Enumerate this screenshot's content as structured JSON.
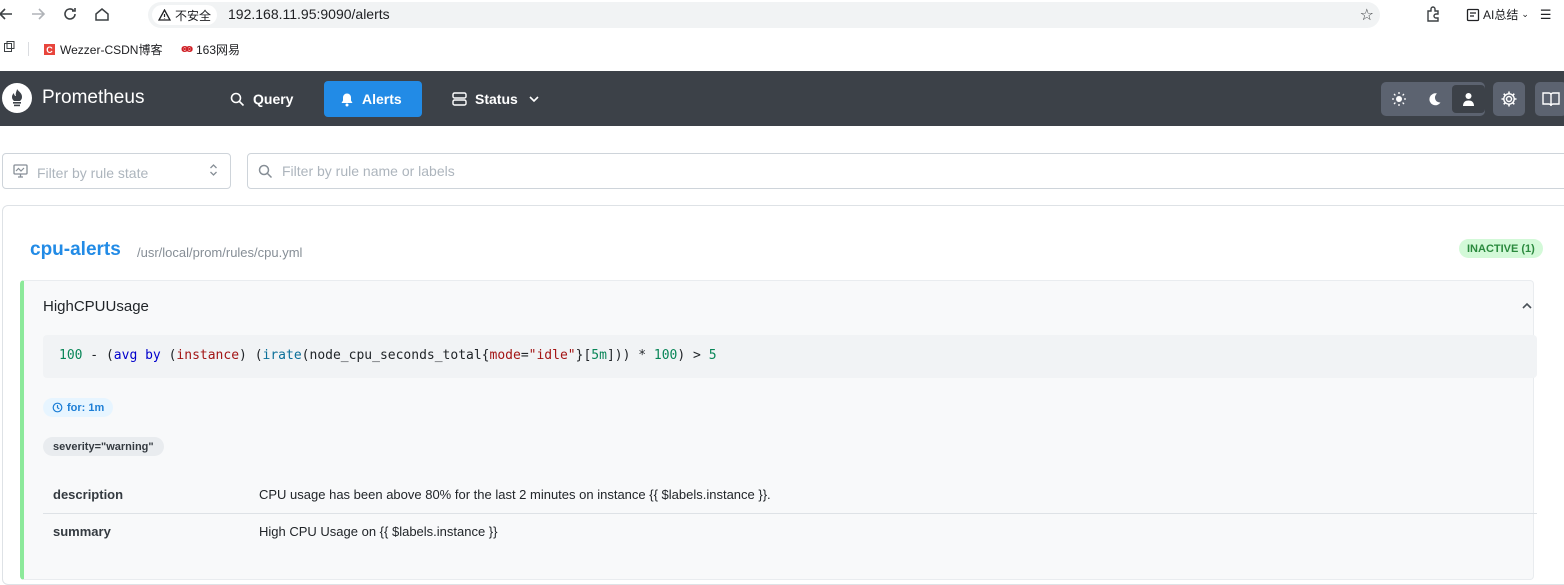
{
  "browser": {
    "security_label": "不安全",
    "url": "192.168.11.95:9090/alerts",
    "ai_label": "AI总结",
    "bookmarks": [
      {
        "label": "Wezzer-CSDN博客",
        "icon": "csdn-icon"
      },
      {
        "label": "163网易",
        "icon": "netease-icon"
      }
    ]
  },
  "header": {
    "brand": "Prometheus",
    "nav": [
      {
        "label": "Query",
        "icon": "search-icon"
      },
      {
        "label": "Alerts",
        "icon": "bell-icon",
        "active": true
      },
      {
        "label": "Status",
        "icon": "server-icon"
      }
    ],
    "accent": "#228be6",
    "header_bg": "#3c4148"
  },
  "filters": {
    "state_placeholder": "Filter by rule state",
    "name_placeholder": "Filter by rule name or labels"
  },
  "group": {
    "name": "cpu-alerts",
    "file": "/usr/local/prom/rules/cpu.yml",
    "badge": "INACTIVE (1)",
    "badge_color": "#2b8a3e",
    "rule": {
      "name": "HighCPUUsage",
      "expr_tokens": {
        "t1": "100",
        "t2": " - (",
        "t3": "avg by",
        "t4": " (",
        "t5": "instance",
        "t6": ") (",
        "t7": "irate",
        "t8": "(node_cpu_seconds_total{",
        "t9": "mode",
        "t10": "=",
        "t11": "\"idle\"",
        "t12": "}[",
        "t13": "5m",
        "t14": "])) * ",
        "t15": "100",
        "t16": ") > ",
        "t17": "5"
      },
      "for": "for: 1m",
      "label": "severity=\"warning\"",
      "annotations": [
        {
          "key": "description",
          "value": "CPU usage has been above 80% for the last 2 minutes on instance {{ $labels.instance }}."
        },
        {
          "key": "summary",
          "value": "High CPU Usage on {{ $labels.instance }}"
        }
      ]
    }
  }
}
